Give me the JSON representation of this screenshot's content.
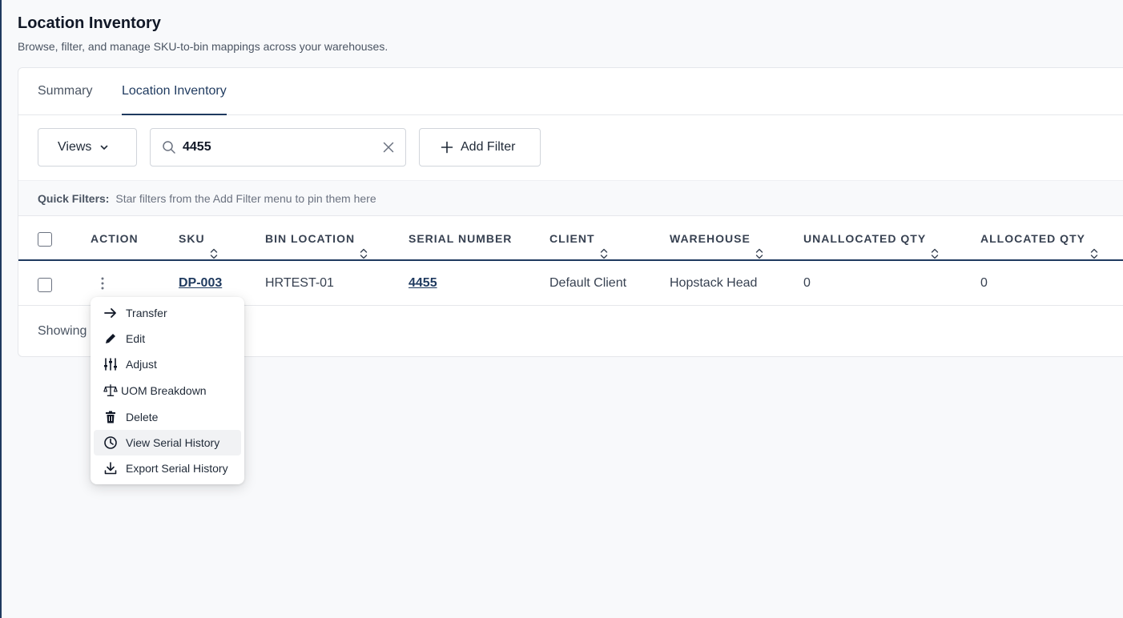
{
  "page": {
    "title": "Location Inventory",
    "subtitle": "Browse, filter, and manage SKU-to-bin mappings across your warehouses."
  },
  "tabs": [
    {
      "label": "Summary",
      "active": false
    },
    {
      "label": "Location Inventory",
      "active": true
    }
  ],
  "toolbar": {
    "views_label": "Views",
    "search_value": "4455",
    "add_filter_label": "Add Filter"
  },
  "quick_filters": {
    "label": "Quick Filters:",
    "hint": "Star filters from the Add Filter menu to pin them here"
  },
  "table": {
    "columns": [
      "ACTION",
      "SKU",
      "BIN LOCATION",
      "SERIAL NUMBER",
      "CLIENT",
      "WAREHOUSE",
      "UNALLOCATED QTY",
      "ALLOCATED QTY"
    ],
    "rows": [
      {
        "sku": "DP-003",
        "bin_location": "HRTEST-01",
        "serial_number": "4455",
        "client": "Default Client",
        "warehouse": "Hopstack Head",
        "unallocated_qty": "0",
        "allocated_qty": "0"
      }
    ],
    "showing_text": "Showing"
  },
  "action_menu": {
    "items": [
      {
        "label": "Transfer",
        "icon": "arrow-right-icon"
      },
      {
        "label": "Edit",
        "icon": "pencil-icon"
      },
      {
        "label": "Adjust",
        "icon": "sliders-icon"
      },
      {
        "label": "UOM Breakdown",
        "icon": "scale-icon"
      },
      {
        "label": "Delete",
        "icon": "trash-icon"
      },
      {
        "label": "View Serial History",
        "icon": "clock-icon",
        "highlighted": true
      },
      {
        "label": "Export Serial History",
        "icon": "download-icon"
      }
    ]
  },
  "colors": {
    "accent": "#1f3a5f",
    "background": "#f8f9fb",
    "border": "#d1d5db"
  }
}
